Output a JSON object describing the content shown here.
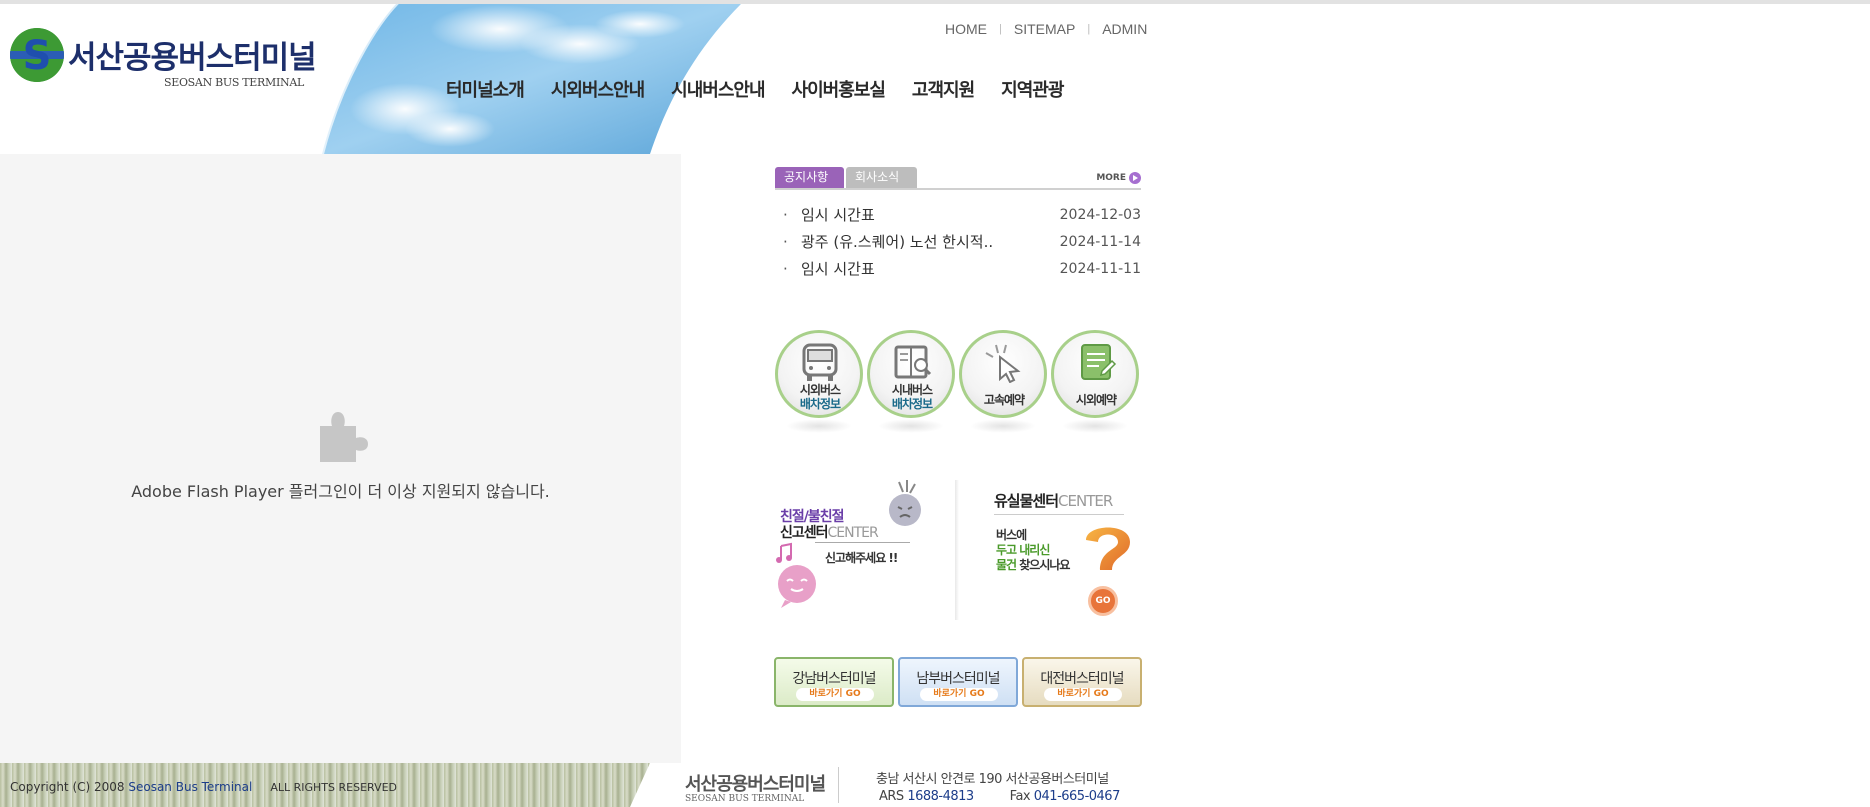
{
  "logo": {
    "ko": "서산공용버스터미널",
    "en": "SEOSAN BUS TERMINAL"
  },
  "util": {
    "home": "HOME",
    "sitemap": "SITEMAP",
    "admin": "ADMIN"
  },
  "gnb": [
    "터미널소개",
    "시외버스안내",
    "시내버스안내",
    "사이버홍보실",
    "고객지원",
    "지역관광"
  ],
  "flash": {
    "message": "Adobe Flash Player 플러그인이 더 이상 지원되지 않습니다."
  },
  "board": {
    "tab_notice": "공지사항",
    "tab_news": "회사소식",
    "more": "MORE",
    "items": [
      {
        "title": "임시 시간표",
        "date": "2024-12-03"
      },
      {
        "title": "광주 (유.스퀘어) 노선 한시적..",
        "date": "2024-11-14"
      },
      {
        "title": "임시 시간표",
        "date": "2024-11-11"
      }
    ]
  },
  "quick": [
    {
      "l1": "시외버스",
      "l2": "배차정보",
      "icon": "bus-icon"
    },
    {
      "l1": "시내버스",
      "l2": "배차정보",
      "icon": "book-icon"
    },
    {
      "l1": "",
      "l2": "고속예약",
      "icon": "cursor-icon"
    },
    {
      "l1": "",
      "l2": "시외예약",
      "icon": "document-icon"
    }
  ],
  "report": {
    "t1": "친절/불친절",
    "t2a": "신고센터",
    "t2b": "CENTER",
    "t3": "신고해주세요 !!"
  },
  "lost": {
    "t1a": "유실물센터",
    "t1b": "CENTER",
    "b1": "버스에",
    "b2": "두고 내리신",
    "b3a": "물건",
    "b3b": " 찾으시나요",
    "go": "GO"
  },
  "terminals": [
    {
      "name": "강남버스터미널",
      "go": "바로가기 GO"
    },
    {
      "name": "남부버스터미널",
      "go": "바로가기 GO"
    },
    {
      "name": "대전버스터미널",
      "go": "바로가기 GO"
    }
  ],
  "footer": {
    "copy_prefix": "Copyright (C) 2008 ",
    "copy_name": "Seosan Bus Terminal",
    "rights": "ALL RIGHTS RESERVED",
    "logo_ko": "서산공용버스터미널",
    "logo_en": "SEOSAN BUS TERMINAL",
    "address": "충남 서산시 안견로 190  서산공용버스터미널",
    "ars_label": "ARS ",
    "ars": "1688-4813",
    "fax_label": "Fax ",
    "fax": "041-665-0467"
  },
  "colors": {
    "navy": "#1d2f6b",
    "purple": "#9a63b8",
    "green": "#a8d08a",
    "accent_orange": "#e67a1a"
  }
}
